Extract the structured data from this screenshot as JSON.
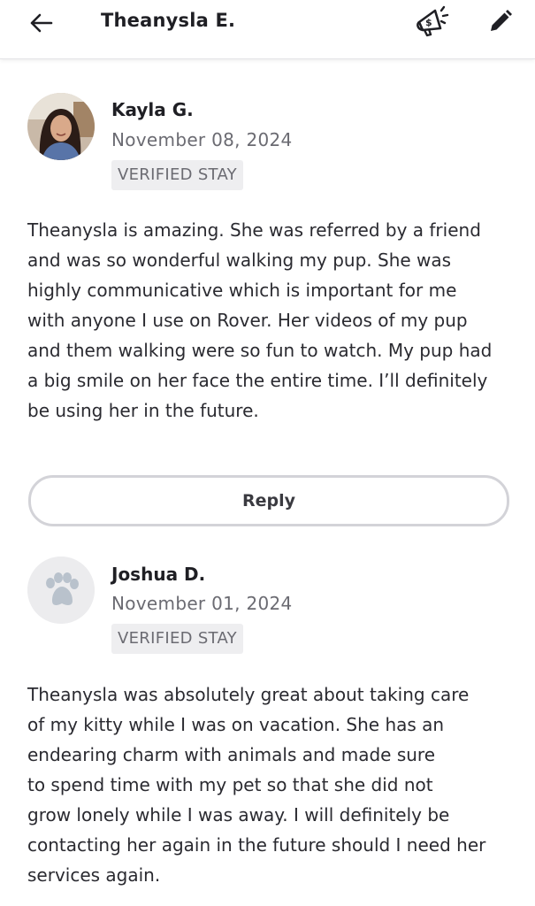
{
  "header": {
    "title": "Theanysla E.",
    "icons": {
      "back": "arrow-left-icon",
      "promo": "megaphone-dollar-icon",
      "edit": "pencil-icon"
    }
  },
  "reviews": [
    {
      "name": "Kayla G.",
      "date": "November 08, 2024",
      "badge": "VERIFIED STAY",
      "avatar": "profile-photo",
      "lines": [
        "Theanysla is amazing. She was referred by a friend",
        "and was so wonderful walking my pup. She was",
        "highly communicative which is important for me",
        "with anyone I use on Rover. Her videos of my pup",
        "and them walking were so fun to watch. My pup had",
        "a big smile on her face the entire time. I’ll definitely",
        "be using her in the future."
      ],
      "reply_label": "Reply"
    },
    {
      "name": "Joshua D.",
      "date": "November 01, 2024",
      "badge": "VERIFIED STAY",
      "avatar": "paw-placeholder-icon",
      "lines": [
        "Theanysla was absolutely great about taking care",
        "of my kitty while I was on vacation. She has an",
        "endearing charm with animals and made sure",
        "to spend time with my pet so that she did not",
        "grow lonely while I was away. I will definitely be",
        "contacting her again in the future should I need her",
        "services again."
      ]
    }
  ],
  "colors": {
    "text": "#1f1f24",
    "muted": "#6b6b72",
    "badge_bg": "#eeeef0",
    "border": "#d3d3d8"
  }
}
